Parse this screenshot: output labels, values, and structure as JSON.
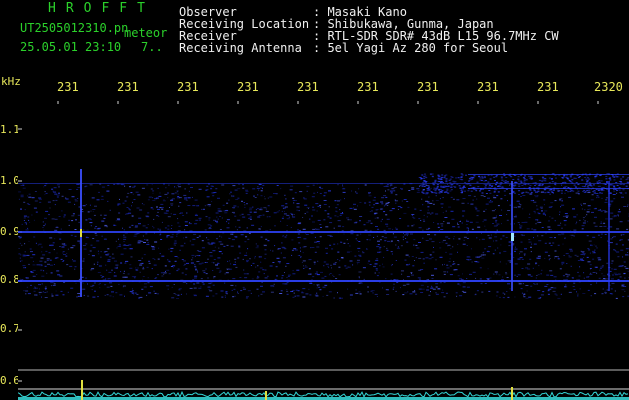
{
  "header": {
    "app_title": "HROFFT",
    "filename": "UT2505012310.pn",
    "meteor_label": "meteor",
    "timestamp": "25.05.01 23:10",
    "count": "7..",
    "info_labels": [
      "Observer",
      "Receiving Location",
      "Receiver",
      "Receiving Antenna"
    ],
    "info_values": [
      ": Masaki Kano",
      ": Shibukawa, Gunma, Japan",
      ": RTL-SDR SDR# 43dB L15 96.7MHz CW",
      ": 5el Yagi Az 280 for Seoul"
    ]
  },
  "time_axis": {
    "ticks": [
      "231",
      "231",
      "231",
      "231",
      "231",
      "231",
      "231",
      "231",
      "231",
      "2320"
    ]
  },
  "freq_axis": {
    "unit": "kHz",
    "ticks": [
      "1.1",
      "1.0",
      "0.9",
      "0.8",
      "0.7",
      "0.6"
    ]
  },
  "colors": {
    "background": "#000000",
    "header_text": "#2bd12b",
    "axis_text": "#e8e85a",
    "signal": "#2a3cff",
    "spectrum": "#33d6d6"
  }
}
